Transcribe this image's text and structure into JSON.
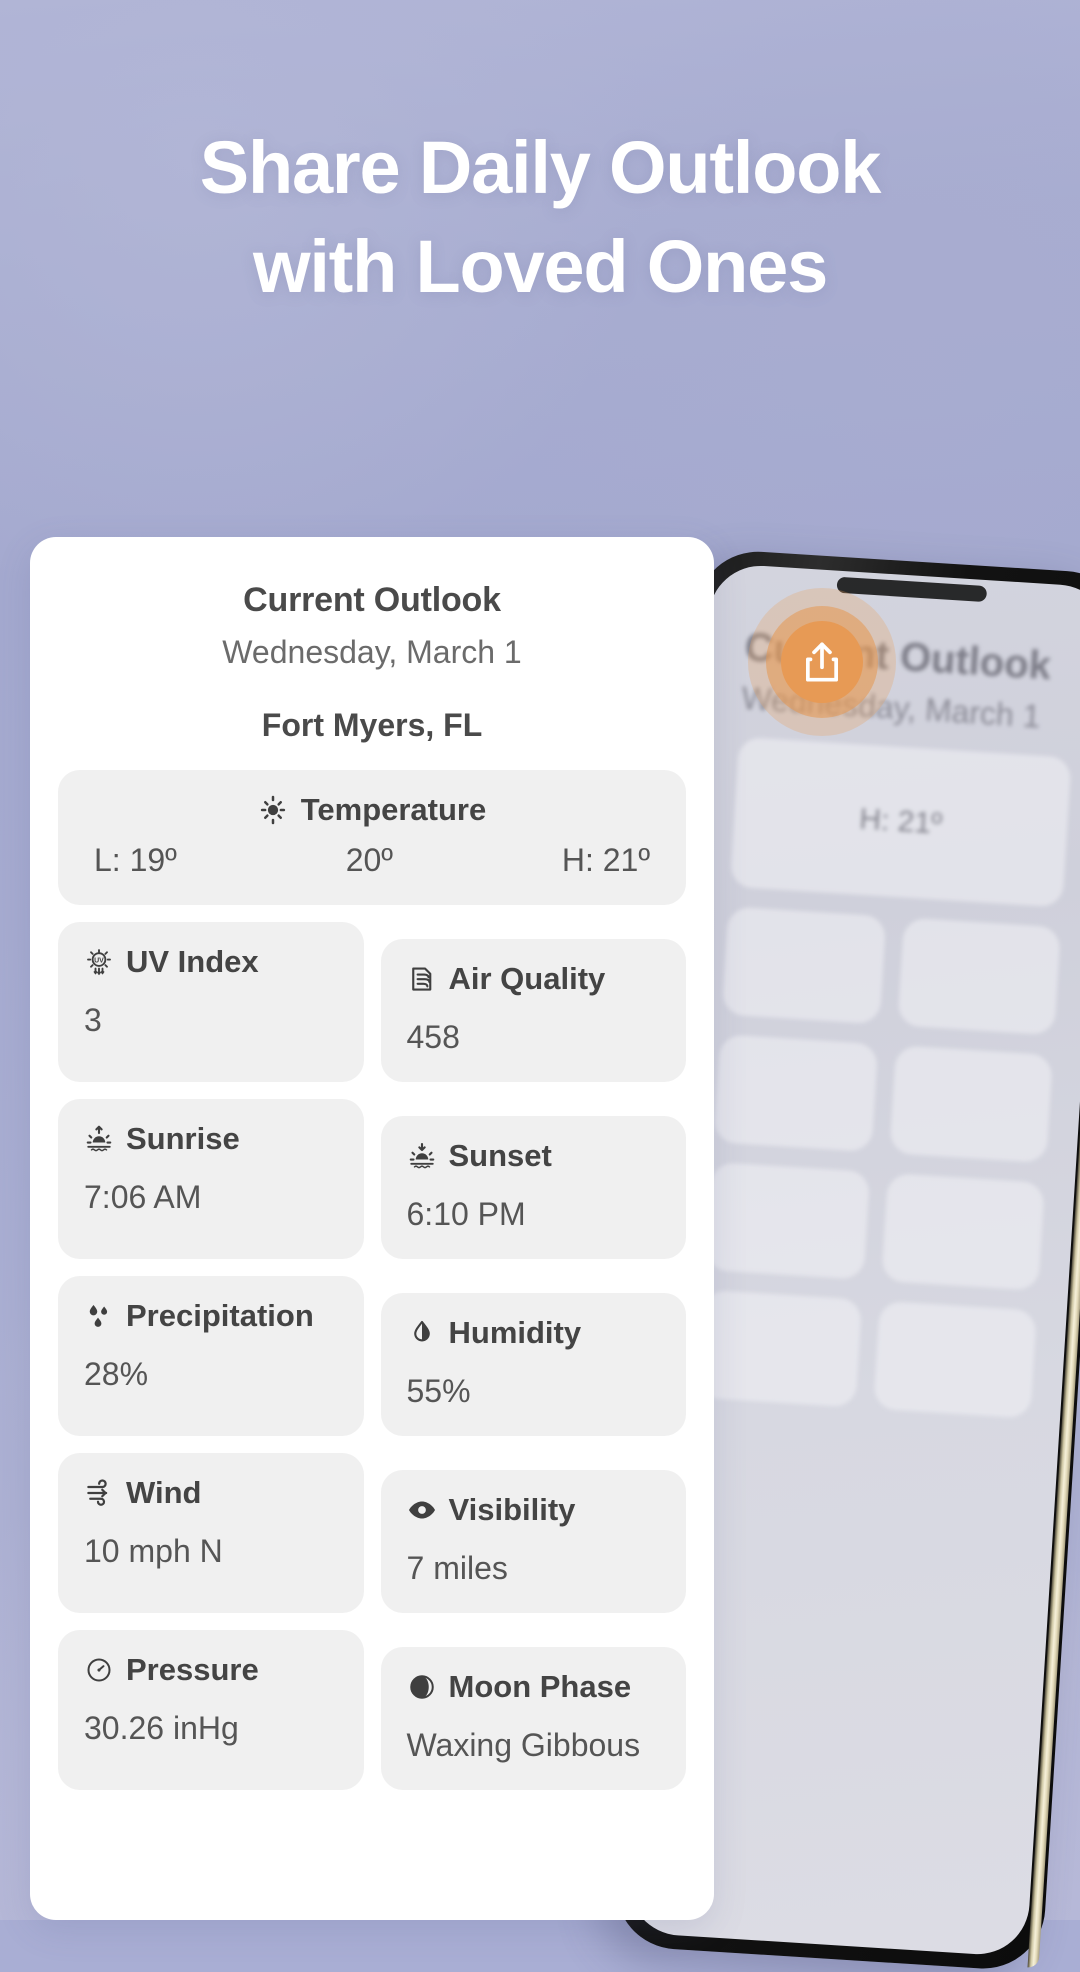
{
  "headline": {
    "line1": "Share Daily Outlook",
    "line2": "with Loved Ones"
  },
  "colors": {
    "background_top": "#b0b4d6",
    "background_bottom": "#b6b8d8",
    "card_background": "#ffffff",
    "tile_background": "#f0f0f0",
    "label_text": "#444444",
    "value_text": "#555555",
    "accent_orange": "#e79a55"
  },
  "card": {
    "title": "Current Outlook",
    "date": "Wednesday, March 1",
    "location": "Fort Myers, FL",
    "temperature": {
      "label": "Temperature",
      "icon": "sun-icon",
      "low": "L: 19º",
      "current": "20º",
      "high": "H: 21º"
    },
    "metrics": [
      {
        "label": "UV Index",
        "icon": "uv-index-icon",
        "value": "3"
      },
      {
        "label": "Air Quality",
        "icon": "air-quality-icon",
        "value": "458"
      },
      {
        "label": "Sunrise",
        "icon": "sunrise-icon",
        "value": "7:06 AM"
      },
      {
        "label": "Sunset",
        "icon": "sunset-icon",
        "value": "6:10 PM"
      },
      {
        "label": "Precipitation",
        "icon": "droplets-icon",
        "value": "28%"
      },
      {
        "label": "Humidity",
        "icon": "droplet-icon",
        "value": "55%"
      },
      {
        "label": "Wind",
        "icon": "wind-icon",
        "value": "10 mph N"
      },
      {
        "label": "Visibility",
        "icon": "eye-icon",
        "value": "7 miles"
      },
      {
        "label": "Pressure",
        "icon": "gauge-icon",
        "value": "30.26 inHg"
      },
      {
        "label": "Moon Phase",
        "icon": "moon-phase-icon",
        "value": "Waxing Gibbous"
      }
    ]
  },
  "phone_preview": {
    "ghost_title": "Current Outlook",
    "ghost_date": "Wednesday, March 1",
    "ghost_high": "H: 21º",
    "share_button_icon": "share-icon"
  }
}
